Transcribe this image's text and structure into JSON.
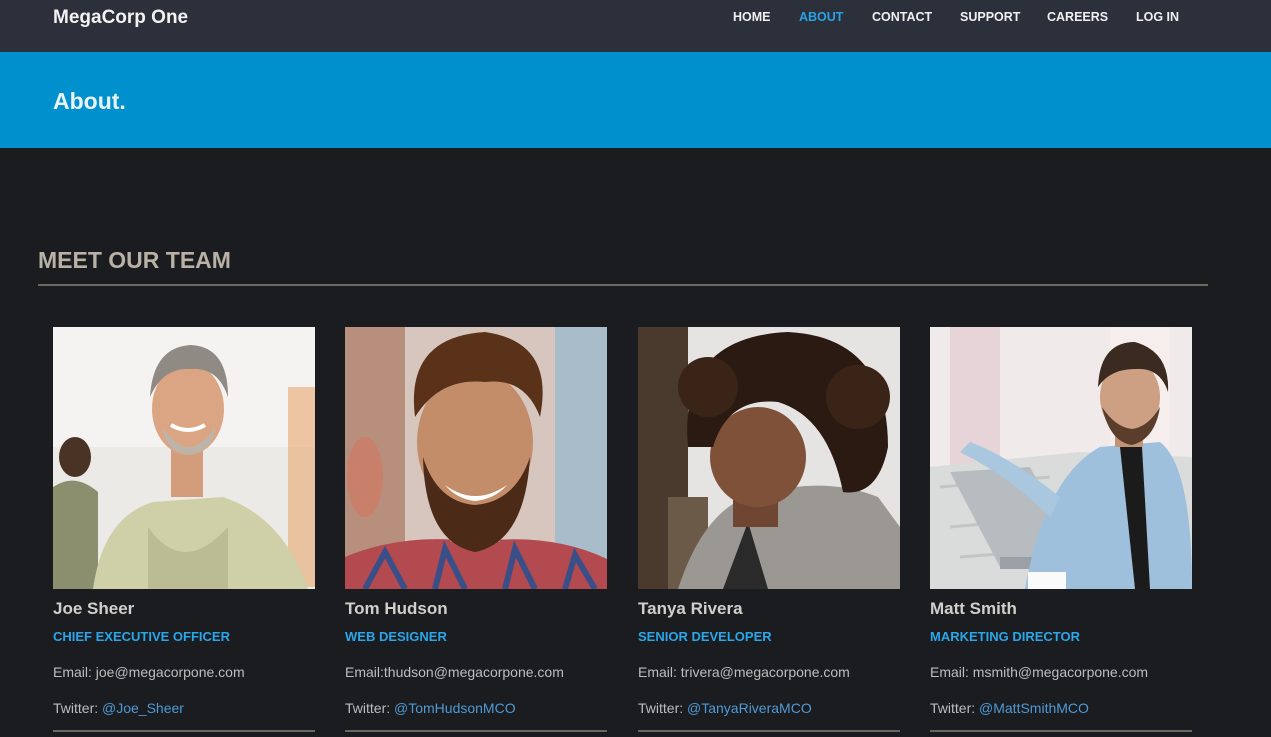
{
  "brand": "MegaCorp One",
  "nav": [
    {
      "label": "HOME",
      "active": false
    },
    {
      "label": "ABOUT",
      "active": true
    },
    {
      "label": "CONTACT",
      "active": false
    },
    {
      "label": "SUPPORT",
      "active": false
    },
    {
      "label": "CAREERS",
      "active": false
    },
    {
      "label": "LOG IN",
      "active": false
    }
  ],
  "banner": {
    "title": "About."
  },
  "section": {
    "title": "MEET OUR TEAM"
  },
  "team": [
    {
      "name": "Joe Sheer",
      "role": "CHIEF EXECUTIVE OFFICER",
      "email": "Email: joe@megacorpone.com",
      "twitter_label": "Twitter: ",
      "twitter_handle": "@Joe_Sheer"
    },
    {
      "name": "Tom Hudson",
      "role": "WEB DESIGNER",
      "email": "Email:thudson@megacorpone.com",
      "twitter_label": "Twitter: ",
      "twitter_handle": "@TomHudsonMCO"
    },
    {
      "name": "Tanya Rivera",
      "role": "SENIOR DEVELOPER",
      "email": "Email: trivera@megacorpone.com",
      "twitter_label": "Twitter: ",
      "twitter_handle": "@TanyaRiveraMCO"
    },
    {
      "name": "Matt Smith",
      "role": "MARKETING DIRECTOR",
      "email": "Email: msmith@megacorpone.com",
      "twitter_label": "Twitter: ",
      "twitter_handle": "@MattSmithMCO"
    }
  ],
  "colors": {
    "navbar_bg": "#2b303b",
    "banner_bg": "#0090ce",
    "page_bg": "#1a1c1f",
    "accent": "#29a3e6",
    "link": "#4f9ad6"
  }
}
